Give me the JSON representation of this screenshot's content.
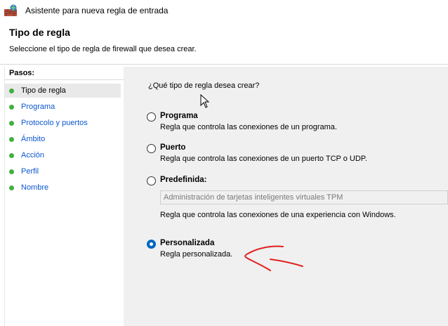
{
  "window": {
    "title": "Asistente para nueva regla de entrada"
  },
  "header": {
    "title": "Tipo de regla",
    "subtitle": "Seleccione el tipo de regla de firewall que desea crear."
  },
  "steps": {
    "heading": "Pasos:",
    "items": [
      {
        "label": "Tipo de regla",
        "current": true
      },
      {
        "label": "Programa"
      },
      {
        "label": "Protocolo y puertos"
      },
      {
        "label": "Ámbito"
      },
      {
        "label": "Acción"
      },
      {
        "label": "Perfil"
      },
      {
        "label": "Nombre"
      }
    ]
  },
  "main": {
    "question": "¿Qué tipo de regla desea crear?",
    "options": [
      {
        "label": "Programa",
        "description": "Regla que controla las conexiones de un programa.",
        "selected": false
      },
      {
        "label": "Puerto",
        "description": "Regla que controla las conexiones de un puerto TCP o UDP.",
        "selected": false
      },
      {
        "label": "Predefinida:",
        "description": "Regla que controla las conexiones de una experiencia con Windows.",
        "selected": false,
        "select_value": "Administración de tarjetas inteligentes virtuales TPM"
      },
      {
        "label": "Personalizada",
        "description": "Regla personalizada.",
        "selected": true
      }
    ]
  },
  "colors": {
    "step_dot": "#3fb13f",
    "link": "#0b57d0",
    "radio_selected": "#0067c0",
    "annotation": "#e02020"
  },
  "icons": {
    "app": "firewall-shield-icon",
    "cursor": "mouse-pointer-icon"
  }
}
